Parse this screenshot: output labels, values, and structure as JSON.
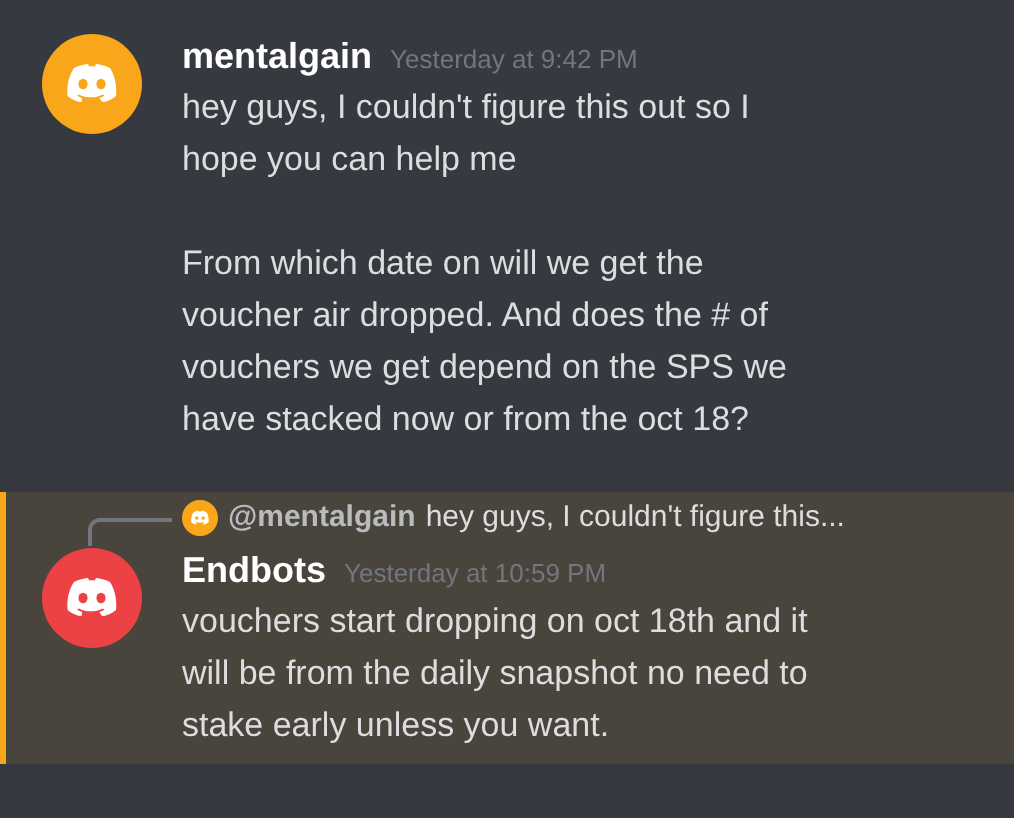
{
  "messages": [
    {
      "author": "mentalgain",
      "timestamp": "Yesterday at 9:42 PM",
      "color": "#faa61a",
      "highlighted": false,
      "paragraphs": [
        "hey guys, I couldn't figure this out so I hope you can help me",
        "From which date on will we get the voucher air dropped. And does the # of vouchers we get depend on the SPS we have stacked now or from the oct 18?"
      ]
    },
    {
      "author": "Endbots",
      "timestamp": "Yesterday at 10:59 PM",
      "color": "#ed4245",
      "highlighted": true,
      "reply": {
        "author": "@mentalgain",
        "color": "#faa61a",
        "preview": "hey guys, I couldn't figure this..."
      },
      "paragraphs": [
        "vouchers start dropping on oct 18th and it will be from the daily snapshot no need to stake early unless you want."
      ]
    }
  ]
}
